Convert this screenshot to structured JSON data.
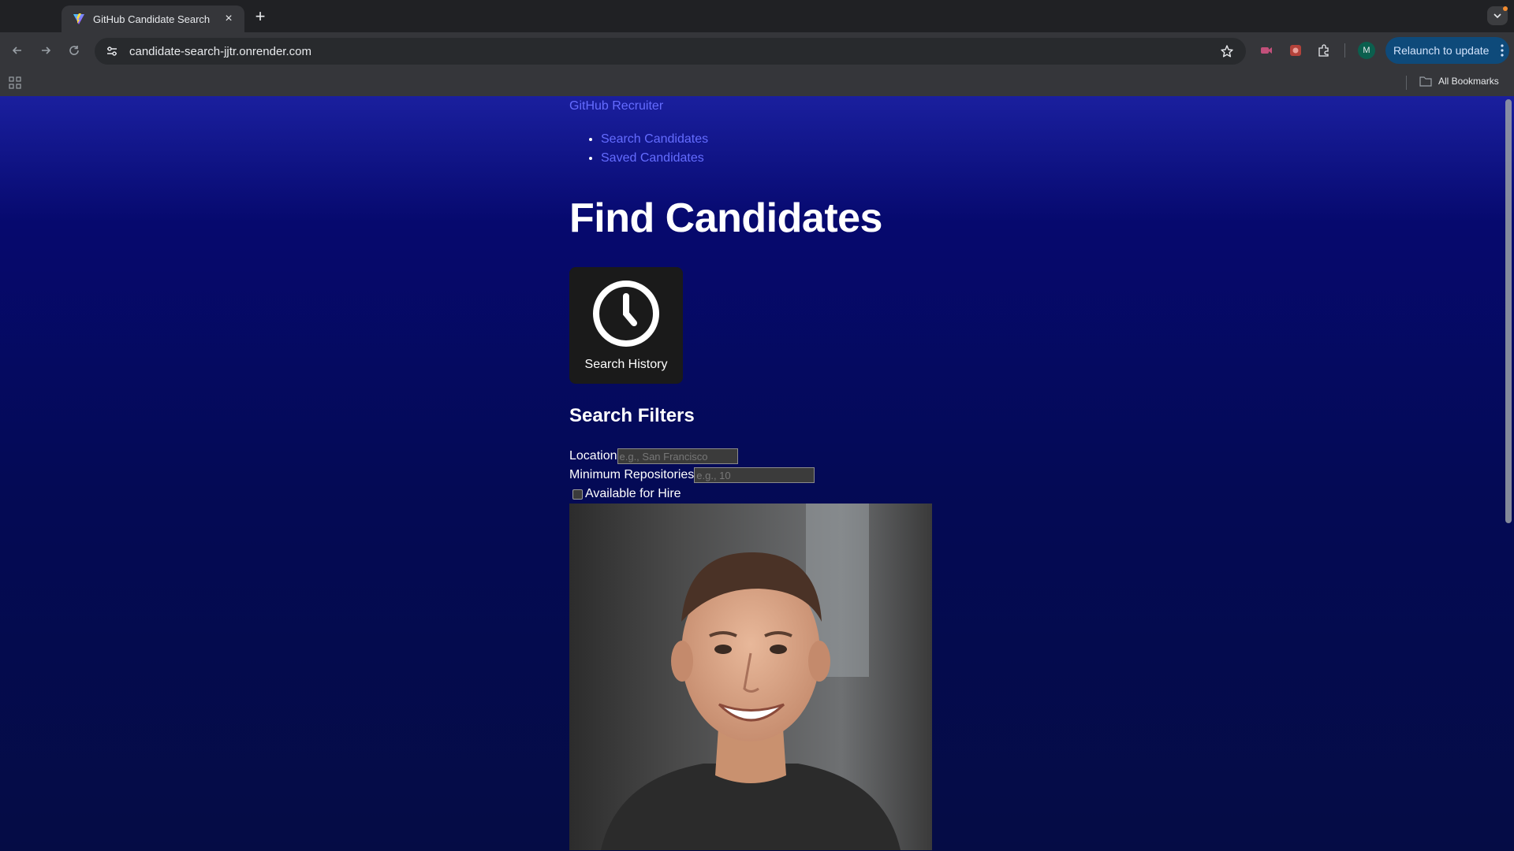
{
  "browser": {
    "tab_title": "GitHub Candidate Search",
    "url": "candidate-search-jjtr.onrender.com",
    "relaunch_label": "Relaunch to update",
    "profile_initial": "M",
    "all_bookmarks_label": "All Bookmarks"
  },
  "page": {
    "brand": "GitHub Recruiter",
    "nav": [
      {
        "label": "Search Candidates"
      },
      {
        "label": "Saved Candidates"
      }
    ],
    "heading": "Find Candidates",
    "history_button_label": "Search History",
    "filters": {
      "title": "Search Filters",
      "location_label": "Location",
      "location_placeholder": "e.g., San Francisco",
      "min_repos_label": "Minimum Repositories",
      "min_repos_placeholder": "e.g., 10",
      "available_label": "Available for Hire",
      "available_checked": false
    }
  },
  "colors": {
    "link": "#646cff",
    "page_gradient_top": "#1a1f9e",
    "page_gradient_bottom": "#050c45",
    "history_button_bg": "#1a1a1a",
    "relaunch_bg": "#0e4a7a"
  },
  "icons": {
    "history": "clock-icon",
    "tab_favicon": "vite-logo-icon",
    "bookmark_star": "star-icon"
  }
}
